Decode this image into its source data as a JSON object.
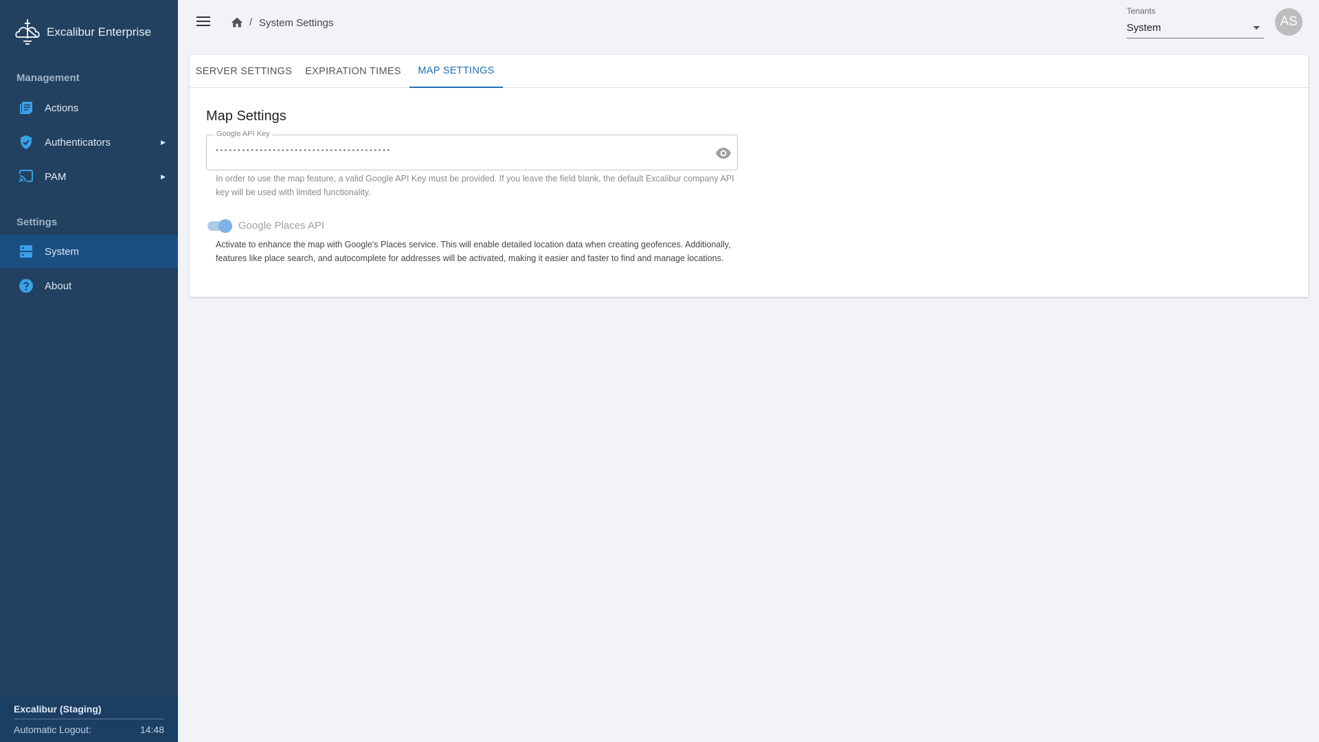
{
  "app": {
    "name": "Excalibur Enterprise"
  },
  "sidebar": {
    "management_label": "Management",
    "settings_label": "Settings",
    "items": [
      {
        "label": "Actions",
        "icon": "list-icon"
      },
      {
        "label": "Authenticators",
        "icon": "shield-check-icon"
      },
      {
        "label": "PAM",
        "icon": "cast-icon"
      },
      {
        "label": "System",
        "icon": "server-icon"
      },
      {
        "label": "About",
        "icon": "help-circle-icon"
      }
    ],
    "active_item": "System",
    "footer": {
      "title": "Excalibur (Staging)",
      "logout_label": "Automatic Logout:",
      "logout_time": "14:48"
    }
  },
  "header": {
    "breadcrumb_separator": "/",
    "breadcrumb_current": "System Settings",
    "tenant_label": "Tenants",
    "tenant_value": "System",
    "avatar_initials": "AS"
  },
  "tabs": [
    {
      "label": "SERVER SETTINGS"
    },
    {
      "label": "EXPIRATION TIMES"
    },
    {
      "label": "MAP SETTINGS"
    }
  ],
  "active_tab": "MAP SETTINGS",
  "map_settings": {
    "title": "Map Settings",
    "api_key_label": "Google API Key",
    "api_key_value": "••••••••••••••••••••••••••••••••••••••••",
    "api_key_help": "In order to use the map feature, a valid Google API Key must be provided. If you leave the field blank, the default Excalibur company API key will be used with limited functionality.",
    "places_toggle_label": "Google Places API",
    "places_toggle_on": true,
    "places_description": "Activate to enhance the map with Google's Places service. This will enable detailed location data when creating geofences. Additionally, features like place search, and autocomplete for addresses will be activated, making it easier and faster to find and manage locations."
  },
  "colors": {
    "sidebar_bg": "#22405f",
    "sidebar_active": "#1a4f82",
    "accent": "#1e6fb5",
    "icon_accent": "#3aa0e8"
  }
}
